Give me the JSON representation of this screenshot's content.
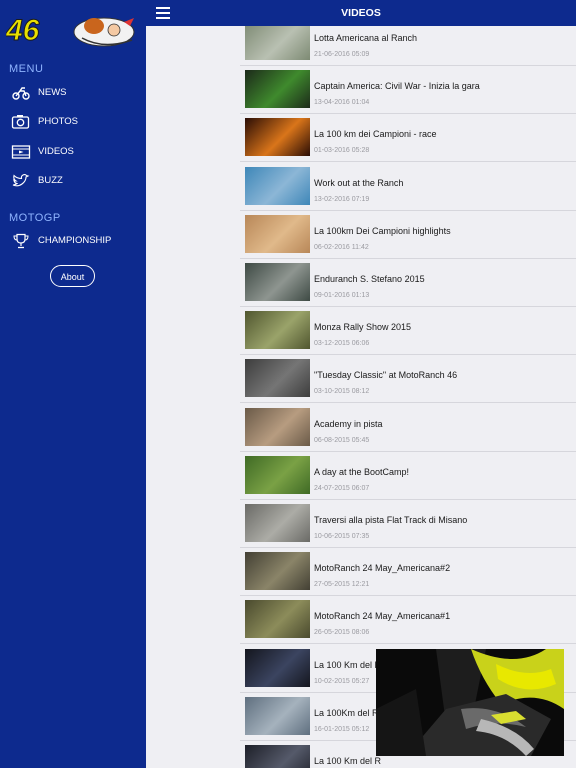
{
  "sidebar": {
    "logo_alt": "46",
    "menu_heading": "MENU",
    "items": [
      {
        "label": "NEWS",
        "icon": "motorbike-icon"
      },
      {
        "label": "PHOTOS",
        "icon": "camera-icon"
      },
      {
        "label": "VIDEOS",
        "icon": "film-icon"
      },
      {
        "label": "BUZZ",
        "icon": "twitter-icon"
      }
    ],
    "motogp_heading": "MOTOGP",
    "championship": {
      "label": "CHAMPIONSHIP",
      "icon": "trophy-icon"
    },
    "about_label": "About"
  },
  "header": {
    "title": "VIDEOS"
  },
  "videos": [
    {
      "title": "Lotta Americana al Ranch",
      "date": "21-06-2016 05:09",
      "thumb": [
        "#7d8a73",
        "#b9c0b2"
      ]
    },
    {
      "title": "Captain America: Civil War - Inizia la gara",
      "date": "13-04-2016 01:04",
      "thumb": [
        "#1c2a1a",
        "#3f8a2d"
      ]
    },
    {
      "title": "La 100 km dei Campioni - race",
      "date": "01-03-2016 05:28",
      "thumb": [
        "#2a0d05",
        "#d9751a"
      ]
    },
    {
      "title": "Work out at the Ranch",
      "date": "13-02-2016 07:19",
      "thumb": [
        "#3e87b8",
        "#8cb6d6"
      ]
    },
    {
      "title": "La 100km Dei Campioni highlights",
      "date": "06-02-2016 11:42",
      "thumb": [
        "#b88758",
        "#e0b98a"
      ]
    },
    {
      "title": "Enduranch S. Stefano 2015",
      "date": "09-01-2016 01:13",
      "thumb": [
        "#3e4a44",
        "#8e9590"
      ]
    },
    {
      "title": "Monza Rally Show 2015",
      "date": "03-12-2015 06:06",
      "thumb": [
        "#50562f",
        "#9aa36a"
      ]
    },
    {
      "title": "\"Tuesday Classic\" at MotoRanch 46",
      "date": "03-10-2015 08:12",
      "thumb": [
        "#3d3d3d",
        "#757575"
      ]
    },
    {
      "title": "Academy in pista",
      "date": "06-08-2015 05:45",
      "thumb": [
        "#6a5a48",
        "#b79c80"
      ]
    },
    {
      "title": "A day at the BootCamp!",
      "date": "24-07-2015 06:07",
      "thumb": [
        "#3f6a25",
        "#7aa145"
      ]
    },
    {
      "title": "Traversi alla pista Flat Track di Misano",
      "date": "10-06-2015 07:35",
      "thumb": [
        "#6a6a66",
        "#acaca6"
      ]
    },
    {
      "title": "MotoRanch 24 May_Americana#2",
      "date": "27-05-2015 12:21",
      "thumb": [
        "#434034",
        "#8a8468"
      ]
    },
    {
      "title": "MotoRanch 24 May_Americana#1",
      "date": "26-05-2015 08:06",
      "thumb": [
        "#4a4a2e",
        "#8c8c5a"
      ]
    },
    {
      "title": "La 100 Km del R",
      "date": "10-02-2015 05:27",
      "thumb": [
        "#14161e",
        "#3b4460"
      ]
    },
    {
      "title": "La 100Km del R",
      "date": "16-01-2015 05:12",
      "thumb": [
        "#5f6f7f",
        "#a5b2bd"
      ]
    },
    {
      "title": "La 100 Km del R",
      "date": "",
      "thumb": [
        "#1d1f28",
        "#555a6a"
      ]
    }
  ],
  "colors": {
    "nav_blue": "#0d2a8e",
    "list_bg": "#efeff3",
    "accent_yellow": "#e8e000"
  }
}
